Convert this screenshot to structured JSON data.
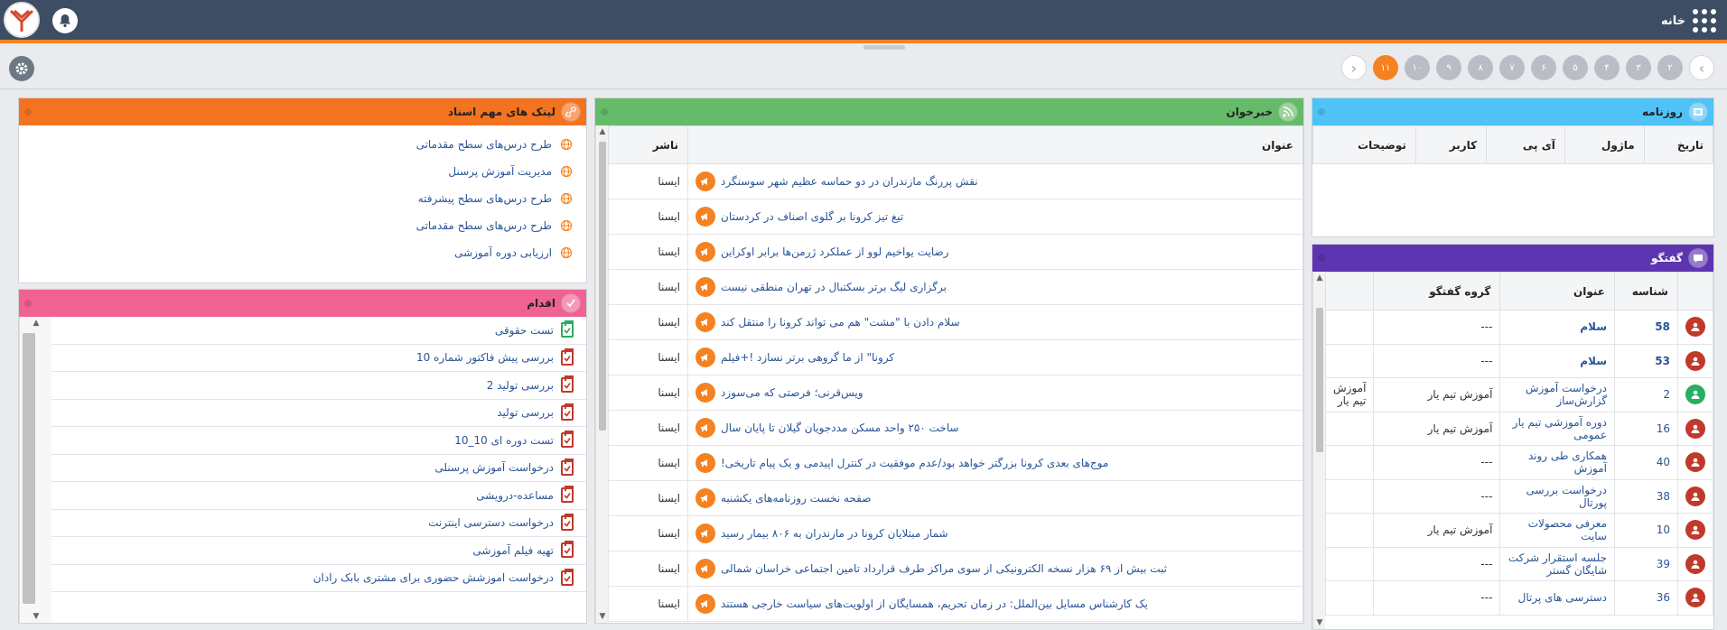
{
  "header": {
    "home_label": "خانه",
    "icons": [
      "apps-grid-icon",
      "bell-icon",
      "logo"
    ]
  },
  "pagination": {
    "pages": [
      "۲",
      "۳",
      "۴",
      "۵",
      "۶",
      "۷",
      "۸",
      "۹",
      "۱۰",
      "۱۱"
    ],
    "active_page": "۱۱",
    "prev": "‹",
    "next": "›"
  },
  "journal": {
    "title": "روزنامه",
    "columns": [
      "تاریخ",
      "ماژول",
      "آی پی",
      "کاربر",
      "توضیحات"
    ],
    "color": "#4fc3f7"
  },
  "chat": {
    "title": "گفتگو",
    "color": "#5e35b1",
    "columns": [
      "شناسه",
      "عنوان",
      "گروه گفتگو"
    ],
    "rows": [
      {
        "id": "58",
        "title": "سلام",
        "group": "---",
        "col4": "",
        "bold": true,
        "avatar": "red"
      },
      {
        "id": "53",
        "title": "سلام",
        "group": "---",
        "col4": "",
        "bold": true,
        "avatar": "red"
      },
      {
        "id": "2",
        "title": "درخواست آموزش گزارش‌ساز",
        "group": "آموزش تیم یار",
        "col4": "آموزش تیم یار",
        "bold": false,
        "avatar": "green"
      },
      {
        "id": "16",
        "title": "دوره آموزشی تیم یار عمومی",
        "group": "آموزش تیم یار",
        "col4": "",
        "bold": false,
        "avatar": "red"
      },
      {
        "id": "40",
        "title": "همکاری طی روند آموزش",
        "group": "---",
        "col4": "",
        "bold": false,
        "avatar": "red"
      },
      {
        "id": "38",
        "title": "درخواست بررسی پورتال",
        "group": "---",
        "col4": "",
        "bold": false,
        "avatar": "red"
      },
      {
        "id": "10",
        "title": "معرفی محصولات سایت",
        "group": "آموزش تیم یار",
        "col4": "",
        "bold": false,
        "avatar": "red"
      },
      {
        "id": "39",
        "title": "جلسه استقرار شرکت شایگان گستر",
        "group": "---",
        "col4": "",
        "bold": false,
        "avatar": "red"
      },
      {
        "id": "36",
        "title": "دسترسی های پرتال",
        "group": "---",
        "col4": "",
        "bold": false,
        "avatar": "red"
      }
    ]
  },
  "news": {
    "title": "خبرخوان",
    "color": "#66bb6a",
    "columns": [
      "عنوان",
      "ناشر"
    ],
    "rows": [
      {
        "title": "نقش پررنگ مازندران در دو حماسه عظیم شهر سوسنگرد",
        "publisher": "ایسنا"
      },
      {
        "title": "تیغ تیز کرونا بر گلوی اصناف در کردستان",
        "publisher": "ایسنا"
      },
      {
        "title": "رضایت یواخیم لوو از عملکرد ژرمن‌ها برابر اوکراین",
        "publisher": "ایسنا"
      },
      {
        "title": "برگزاری لیگ برتر بسکتبال در تهران منطقی نیست",
        "publisher": "ایسنا"
      },
      {
        "title": "سلام دادن با \"مشت\" هم می تواند کرونا را منتقل کند",
        "publisher": "ایسنا"
      },
      {
        "title": "کرونا\" از ما گروهی برتر نسازد !+فیلم",
        "publisher": "ایسنا"
      },
      {
        "title": "ویس‌قرنی؛ فرصتی که می‌سوزد",
        "publisher": "ایسنا"
      },
      {
        "title": "ساخت ۲۵۰ واحد مسکن مددجویان گیلان تا پایان سال",
        "publisher": "ایسنا"
      },
      {
        "title": "موج‌های بعدی کرونا بزرگتر خواهد بود/عدم موفقیت در کنترل اپیدمی و یک پیام تاریخی!",
        "publisher": "ایسنا"
      },
      {
        "title": "صفحه نخست روزنامه‌های یکشنبه",
        "publisher": "ایسنا"
      },
      {
        "title": "شمار مبتلایان کرونا در مازندران به ۸۰۶ بیمار رسید",
        "publisher": "ایسنا"
      },
      {
        "title": "ثبت بیش از ۶۹ هزار نسخه الکترونیکی از سوی مراکز طرف قرارداد تامین اجتماعی خراسان شمالی",
        "publisher": "ایسنا"
      },
      {
        "title": "یک کارشناس مسایل بین‌الملل: در زمان تحریم، همسایگان از اولویت‌های سیاست خارجی هستند",
        "publisher": "ایسنا"
      }
    ]
  },
  "links": {
    "title": "لینک های مهم اسناد",
    "color": "#f47321",
    "items": [
      "طرح درس‌های سطح مقدماتی",
      "مدیریت آموزش پرسنل",
      "طرح درس‌های سطح پیشرفته",
      "طرح درس‌های سطح مقدماتی",
      "ارزیابی دوره آموزشی"
    ]
  },
  "actions": {
    "title": "اقدام",
    "color": "#f06292",
    "items": [
      {
        "label": "تست حقوقی",
        "done": true
      },
      {
        "label": "بررسی پیش فاکتور شماره 10",
        "done": false
      },
      {
        "label": "بررسی تولید 2",
        "done": false
      },
      {
        "label": "بررسی تولید",
        "done": false
      },
      {
        "label": "تست دوره ای 10_10",
        "done": false
      },
      {
        "label": "درخواست آموزش پرسنلی",
        "done": false
      },
      {
        "label": "مساعده-درویشی",
        "done": false
      },
      {
        "label": "درخواست دسترسی اینترنت",
        "done": false
      },
      {
        "label": "تهیه فیلم آموزشی",
        "done": false
      },
      {
        "label": "درخواست اموزشش حضوری برای مشتری بابک رادان",
        "done": false
      }
    ]
  }
}
